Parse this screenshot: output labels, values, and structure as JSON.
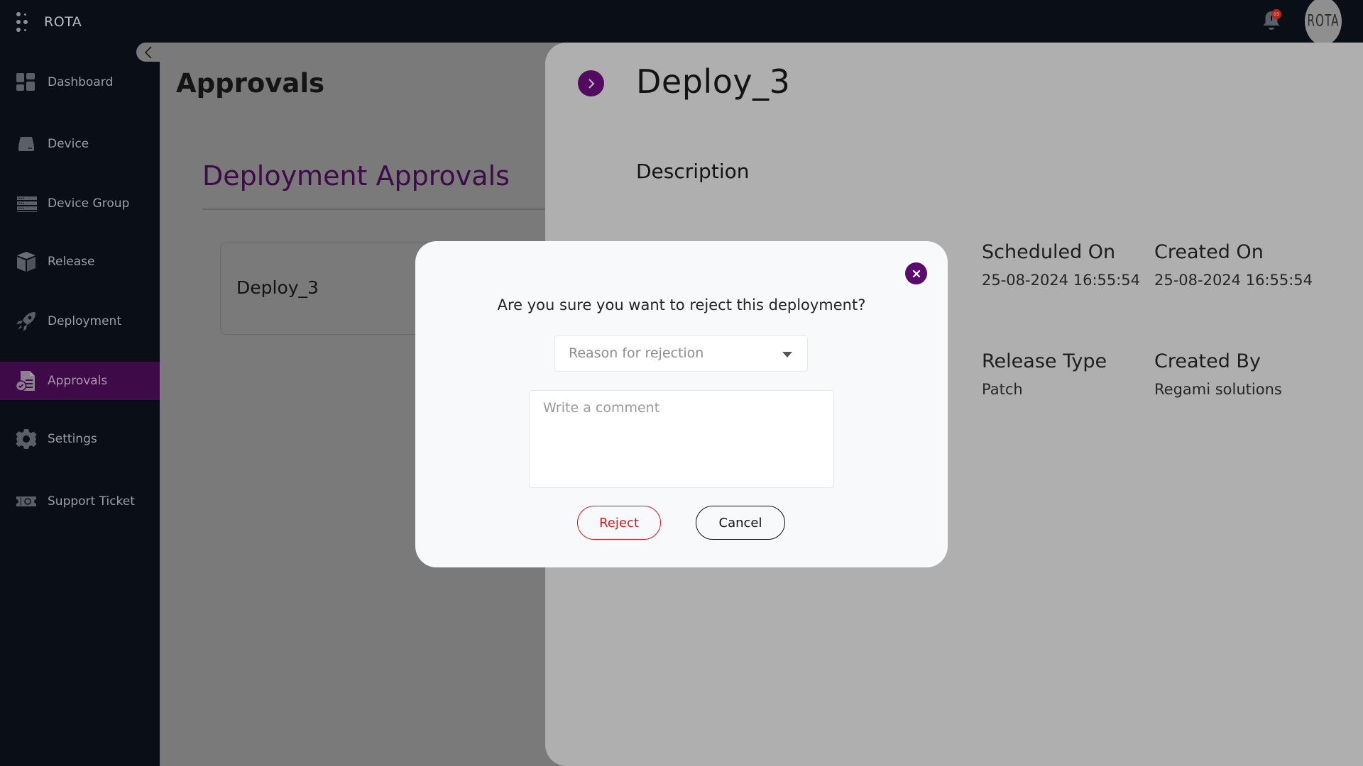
{
  "app": {
    "name": "ROTA",
    "avatar_text": "ROTA",
    "notification_count": "03"
  },
  "sidebar": {
    "items": [
      {
        "label": "Dashboard",
        "icon": "dashboard-icon",
        "active": false
      },
      {
        "label": "Device",
        "icon": "device-icon",
        "active": false
      },
      {
        "label": "Device Group",
        "icon": "device-group-icon",
        "active": false
      },
      {
        "label": "Release",
        "icon": "release-box-icon",
        "active": false
      },
      {
        "label": "Deployment",
        "icon": "rocket-icon",
        "active": false
      },
      {
        "label": "Approvals",
        "icon": "approvals-document-icon",
        "active": true
      },
      {
        "label": "Settings",
        "icon": "gear-icon",
        "active": false
      },
      {
        "label": "Support Ticket",
        "icon": "ticket-icon",
        "active": false
      }
    ]
  },
  "main": {
    "page_title": "Approvals",
    "section_title": "Deployment Approvals",
    "list": [
      {
        "title": "Deploy_3"
      }
    ]
  },
  "detail": {
    "title": "Deploy_3",
    "description_label": "Description",
    "fields": {
      "scheduled_on": {
        "label": "Scheduled On",
        "value": "25-08-2024 16:55:54"
      },
      "created_on": {
        "label": "Created On",
        "value": "25-08-2024 16:55:54"
      },
      "release_type": {
        "label": "Release Type",
        "value": "Patch"
      },
      "created_by": {
        "label": "Created By",
        "value": "Regami solutions"
      }
    }
  },
  "modal": {
    "question": "Are you sure you want to reject this deployment?",
    "reason_placeholder": "Reason for rejection",
    "comment_placeholder": "Write a comment",
    "comment_value": "",
    "reject_label": "Reject",
    "cancel_label": "Cancel"
  },
  "colors": {
    "accent": "#3e0a48",
    "accent_button": "#5a0b6b",
    "reject": "#e0161b",
    "notification": "#b3271b"
  }
}
